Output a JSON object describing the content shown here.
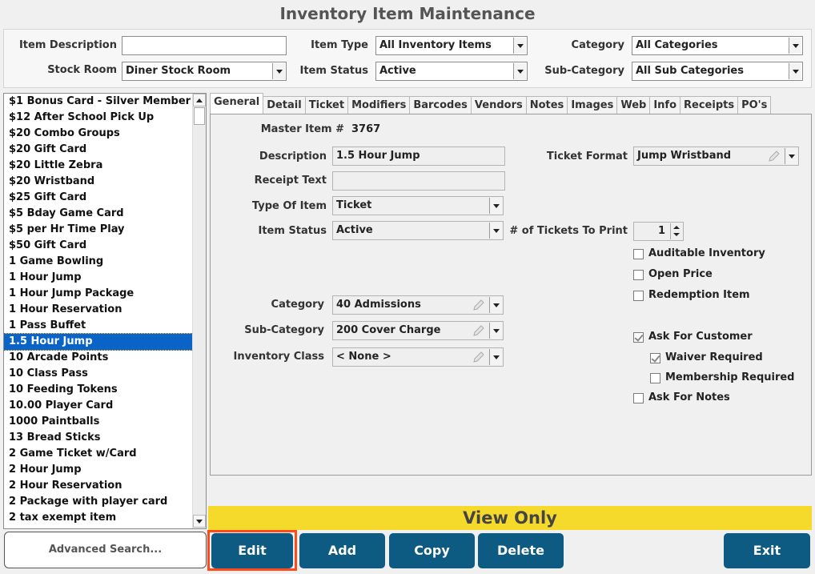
{
  "window": {
    "title": "Inventory Item Maintenance"
  },
  "filters": {
    "item_description_label": "Item Description",
    "item_description_value": "",
    "stock_room_label": "Stock Room",
    "stock_room_value": "Diner Stock Room",
    "item_type_label": "Item Type",
    "item_type_value": "All Inventory Items",
    "item_status_label": "Item Status",
    "item_status_value": "Active",
    "category_label": "Category",
    "category_value": "All Categories",
    "subcategory_label": "Sub-Category",
    "subcategory_value": "All Sub Categories"
  },
  "item_list": {
    "items": [
      "$1 Bonus Card -  Silver Member",
      "$12 After School Pick Up",
      "$20 Combo Groups",
      "$20 Gift Card",
      "$20 Little Zebra",
      "$20 Wristband",
      "$25 Gift Card",
      "$5 Bday Game Card",
      "$5 per Hr Time Play",
      "$50 Gift Card",
      "1 Game Bowling",
      "1 Hour Jump",
      "1 Hour Jump Package",
      "1 Hour Reservation",
      "1 Pass Buffet",
      "1.5 Hour Jump",
      "10 Arcade Points",
      "10 Class Pass",
      "10 Feeding Tokens",
      "10.00 Player Card",
      "1000 Paintballs",
      "13 Bread Sticks",
      "2 Game Ticket w/Card",
      "2 Hour Jump",
      "2 Hour Reservation",
      "2 Package with player card",
      "2 tax exempt item"
    ],
    "selected": "1.5 Hour Jump",
    "advanced_search": "Advanced Search..."
  },
  "tabs": [
    "General",
    "Detail",
    "Ticket",
    "Modifiers",
    "Barcodes",
    "Vendors",
    "Notes",
    "Images",
    "Web",
    "Info",
    "Receipts",
    "PO's"
  ],
  "active_tab": "General",
  "general": {
    "master_item_label": "Master Item #",
    "master_item_value": "3767",
    "description_label": "Description",
    "description_value": "1.5 Hour Jump",
    "receipt_text_label": "Receipt Text",
    "receipt_text_value": "",
    "type_of_item_label": "Type Of Item",
    "type_of_item_value": "Ticket",
    "item_status_label": "Item Status",
    "item_status_value": "Active",
    "category_label": "Category",
    "category_value": "40 Admissions",
    "subcategory_label": "Sub-Category",
    "subcategory_value": "200 Cover Charge",
    "inventory_class_label": "Inventory Class",
    "inventory_class_value": "< None >",
    "ticket_format_label": "Ticket Format",
    "ticket_format_value": "Jump Wristband",
    "tickets_to_print_label": "# of Tickets To Print",
    "tickets_to_print_value": "1",
    "checkboxes": {
      "auditable": {
        "label": "Auditable Inventory",
        "checked": false
      },
      "open_price": {
        "label": "Open Price",
        "checked": false
      },
      "redemption": {
        "label": "Redemption Item",
        "checked": false
      },
      "ask_customer": {
        "label": "Ask For Customer",
        "checked": true
      },
      "waiver": {
        "label": "Waiver Required",
        "checked": true
      },
      "membership": {
        "label": "Membership Required",
        "checked": false
      },
      "ask_notes": {
        "label": "Ask For Notes",
        "checked": false
      }
    }
  },
  "status_banner": "View Only",
  "actions": {
    "edit": "Edit",
    "add": "Add",
    "copy": "Copy",
    "delete": "Delete",
    "exit": "Exit"
  },
  "colors": {
    "accent_button": "#0d5a82",
    "banner": "#f5d92b",
    "selection": "#0a64c8",
    "highlight": "#ff4a1a"
  },
  "icons": {
    "pencil": "pencil-icon",
    "dropdown": "chevron-down-icon"
  }
}
